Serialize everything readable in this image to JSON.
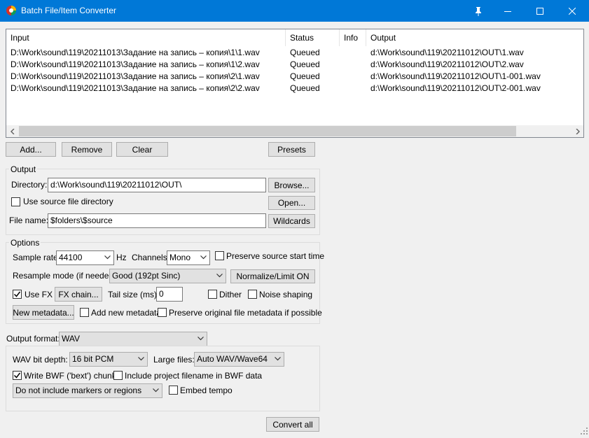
{
  "window": {
    "title": "Batch File/Item Converter"
  },
  "list": {
    "columns": [
      "Input",
      "Status",
      "Info",
      "Output"
    ],
    "rows": [
      {
        "input": "D:\\Work\\sound\\119\\20211013\\Задание на запись – копия\\1\\1.wav",
        "status": "Queued",
        "info": "",
        "output": "d:\\Work\\sound\\119\\20211012\\OUT\\1.wav"
      },
      {
        "input": "D:\\Work\\sound\\119\\20211013\\Задание на запись – копия\\1\\2.wav",
        "status": "Queued",
        "info": "",
        "output": "d:\\Work\\sound\\119\\20211012\\OUT\\2.wav"
      },
      {
        "input": "D:\\Work\\sound\\119\\20211013\\Задание на запись – копия\\2\\1.wav",
        "status": "Queued",
        "info": "",
        "output": "d:\\Work\\sound\\119\\20211012\\OUT\\1-001.wav"
      },
      {
        "input": "D:\\Work\\sound\\119\\20211013\\Задание на запись – копия\\2\\2.wav",
        "status": "Queued",
        "info": "",
        "output": "d:\\Work\\sound\\119\\20211012\\OUT\\2-001.wav"
      }
    ]
  },
  "list_buttons": {
    "add": "Add...",
    "remove": "Remove",
    "clear": "Clear",
    "presets": "Presets"
  },
  "output": {
    "group_label": "Output",
    "directory_label": "Directory:",
    "directory_value": "d:\\Work\\sound\\119\\20211012\\OUT\\",
    "browse": "Browse...",
    "use_source_label": "Use source file directory",
    "use_source_checked": false,
    "open": "Open...",
    "filename_label": "File name:",
    "filename_value": "$folders\\$source",
    "wildcards": "Wildcards"
  },
  "options": {
    "group_label": "Options",
    "sample_rate_label": "Sample rate:",
    "sample_rate_value": "44100",
    "hz": "Hz",
    "channels_label": "Channels:",
    "channels_value": "Mono",
    "preserve_start_label": "Preserve source start time",
    "preserve_start_checked": false,
    "resample_label": "Resample mode (if needed):",
    "resample_value": "Good (192pt Sinc)",
    "normalize": "Normalize/Limit ON",
    "use_fx_label": "Use FX",
    "use_fx_checked": true,
    "fx_chain": "FX chain...",
    "tail_label": "Tail size (ms):",
    "tail_value": "0",
    "dither_label": "Dither",
    "dither_checked": false,
    "noise_shaping_label": "Noise shaping",
    "noise_shaping_checked": false,
    "new_metadata": "New metadata...",
    "add_metadata_label": "Add new metadata",
    "add_metadata_checked": false,
    "preserve_metadata_label": "Preserve original file metadata if possible",
    "preserve_metadata_checked": false
  },
  "format": {
    "label": "Output format:",
    "value": "WAV",
    "bit_depth_label": "WAV bit depth:",
    "bit_depth_value": "16 bit PCM",
    "large_files_label": "Large files:",
    "large_files_value": "Auto WAV/Wave64",
    "bwf_label": "Write BWF ('bext') chunk",
    "bwf_checked": true,
    "include_project_label": "Include project filename in BWF data",
    "include_project_checked": false,
    "markers_value": "Do not include markers or regions",
    "embed_tempo_label": "Embed tempo",
    "embed_tempo_checked": false
  },
  "convert_all": "Convert all"
}
